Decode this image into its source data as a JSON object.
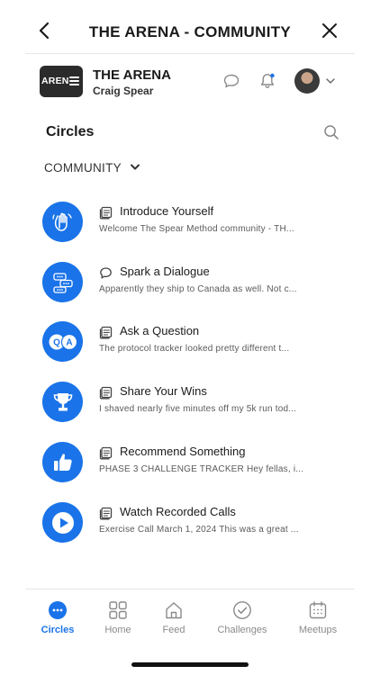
{
  "topbar": {
    "title": "THE ARENA - COMMUNITY"
  },
  "community": {
    "logo_text": "AREN",
    "name": "THE ARENA",
    "user": "Craig Spear"
  },
  "circles": {
    "section_title": "Circles",
    "filter_label": "COMMUNITY",
    "items": [
      {
        "title": "Introduce Yourself",
        "preview": "Welcome The Spear Method community - TH...",
        "type_icon": "post-icon",
        "circle_icon": "waving-hand-icon"
      },
      {
        "title": "Spark a Dialogue",
        "preview": "Apparently they ship to Canada as well. Not c...",
        "type_icon": "chat-bubble-icon",
        "circle_icon": "chat-bubbles-icon"
      },
      {
        "title": "Ask a Question",
        "preview": "The protocol tracker looked pretty different t...",
        "type_icon": "post-icon",
        "circle_icon": "qa-icon"
      },
      {
        "title": "Share Your Wins",
        "preview": "I shaved nearly five minutes off my 5k run tod...",
        "type_icon": "post-icon",
        "circle_icon": "trophy-icon"
      },
      {
        "title": "Recommend Something",
        "preview": "PHASE 3 CHALLENGE TRACKER Hey fellas, i...",
        "type_icon": "post-icon",
        "circle_icon": "thumbs-up-icon"
      },
      {
        "title": "Watch Recorded Calls",
        "preview": "Exercise Call March 1, 2024 This was a great ...",
        "type_icon": "post-icon",
        "circle_icon": "play-icon"
      }
    ]
  },
  "bottom_nav": {
    "items": [
      {
        "label": "Circles",
        "icon": "circles-icon",
        "active": true
      },
      {
        "label": "Home",
        "icon": "grid-icon",
        "active": false
      },
      {
        "label": "Feed",
        "icon": "feed-house-icon",
        "active": false
      },
      {
        "label": "Challenges",
        "icon": "check-circle-icon",
        "active": false
      },
      {
        "label": "Meetups",
        "icon": "calendar-icon",
        "active": false
      }
    ]
  },
  "colors": {
    "accent": "#1a73e8",
    "text": "#1a1a1a",
    "muted": "#8a8a8a"
  }
}
